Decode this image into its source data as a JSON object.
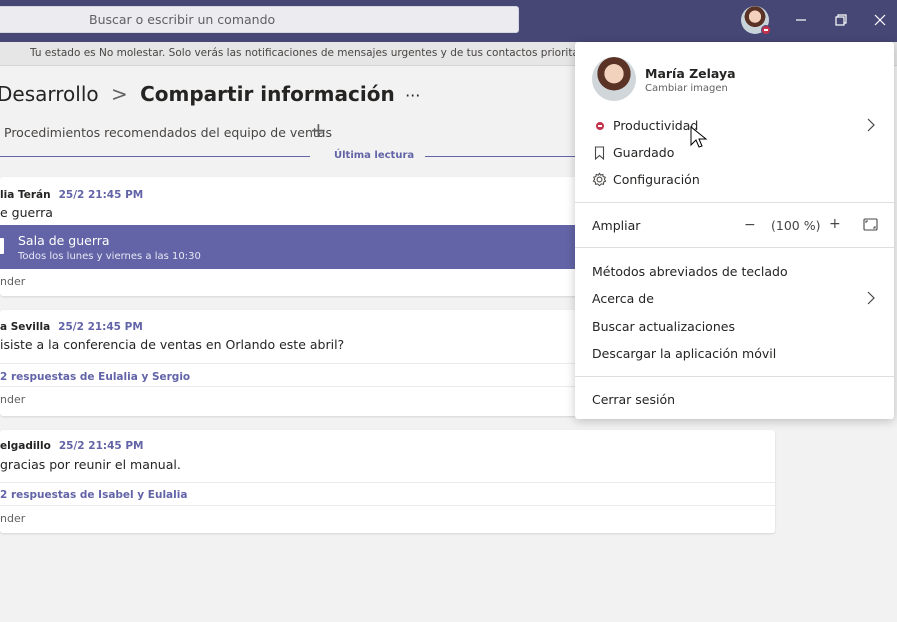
{
  "search": {
    "placeholder": "Buscar o escribir un comando"
  },
  "notice": "Tu estado es No molestar. Solo verás las notificaciones de mensajes urgentes y de tus contactos prioritarios.",
  "breadcrumb": {
    "parent": "Desarrollo",
    "separator": ">",
    "current": "Compartir información",
    "more": "···"
  },
  "tabs": {
    "tab1": "Procedimientos recomendados del equipo de ventas",
    "add": "+"
  },
  "last_read": "Última lectura",
  "posts": [
    {
      "author": "lia Terán",
      "time": "25/2 21:45 PM",
      "text": "e guerra",
      "meeting_title": "Sala de guerra",
      "meeting_sub": "Todos los lunes y viernes a las 10:30",
      "reply": "nder"
    },
    {
      "author": "a Sevilla",
      "time": "25/2 21:45 PM",
      "text": "isiste a la conferencia de ventas en Orlando este abril?",
      "replies": "2 respuestas de Eulalia y Sergio",
      "reply": "nder"
    },
    {
      "author": "elgadillo",
      "time": "25/2 21:45 PM",
      "text": "gracias por reunir el manual.",
      "replies": "2 respuestas de Isabel y Eulalia",
      "reply": "nder"
    }
  ],
  "menu": {
    "name": "María Zelaya",
    "change_image": "Cambiar imagen",
    "status": "Productividad",
    "saved": "Guardado",
    "settings": "Configuración",
    "zoom_label": "Ampliar",
    "zoom_minus": "−",
    "zoom_value": "(100 %)",
    "zoom_plus": "+",
    "shortcuts": "Métodos abreviados de teclado",
    "about": "Acerca de",
    "updates": "Buscar actualizaciones",
    "mobile": "Descargar la aplicación móvil",
    "signout": "Cerrar sesión"
  },
  "colors": {
    "titlebar": "#464775",
    "accent": "#6264a7",
    "dnd": "#c4314b"
  }
}
